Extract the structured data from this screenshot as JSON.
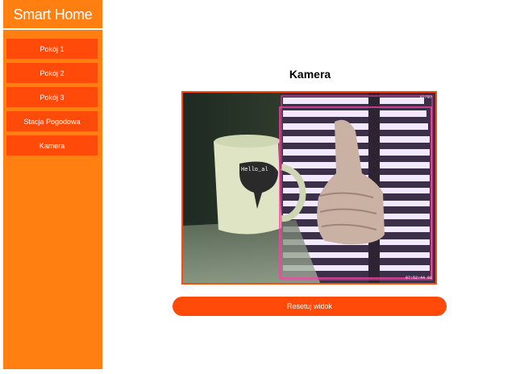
{
  "app": {
    "title": "Smart Home"
  },
  "sidebar": {
    "items": [
      {
        "label": "Pokój 1"
      },
      {
        "label": "Pokój 2"
      },
      {
        "label": "Pokój 3"
      },
      {
        "label": "Stacja Pogodowa"
      },
      {
        "label": "Kamera"
      }
    ]
  },
  "main": {
    "title": "Kamera",
    "camera": {
      "mug_text": "Hello_al",
      "timestamp_top": "07/0?",
      "timestamp_bottom": "07:52:44 01"
    },
    "reset_label": "Resetuj widok"
  },
  "colors": {
    "sidebar": "#ff7f11",
    "accent": "#ff4a0a"
  }
}
